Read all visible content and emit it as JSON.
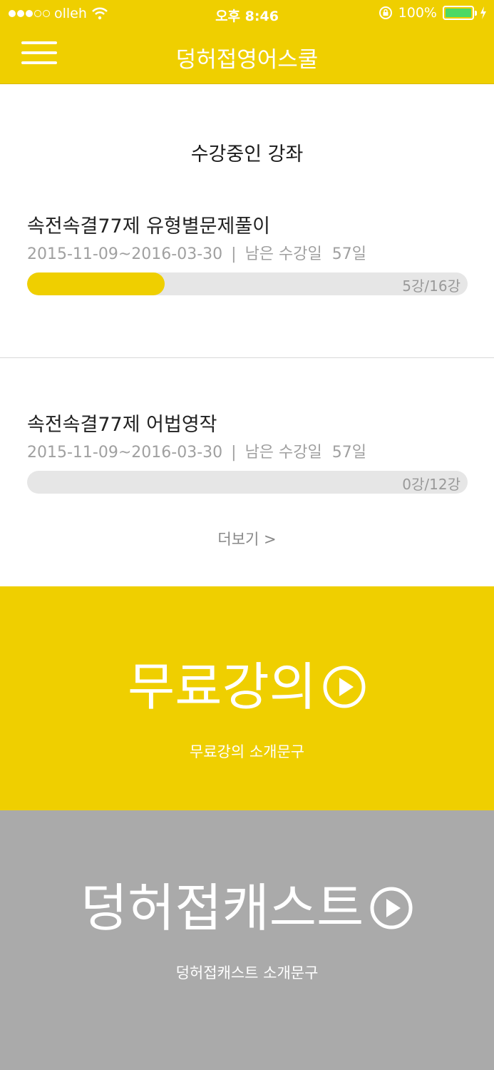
{
  "status": {
    "carrier": "olleh",
    "time": "오후 8:46",
    "battery": "100%",
    "signal_bars_filled": 3,
    "signal_bars_total": 5
  },
  "nav": {
    "title": "덩허접영어스쿨"
  },
  "enrolled": {
    "title": "수강중인 강좌",
    "courses": [
      {
        "title": "속전속결77제 유형별문제풀이",
        "period": "2015-11-09~2016-03-30",
        "separator": "|",
        "remaining_label": "남은 수강일",
        "remaining_days": "57일",
        "progress_text": "5강/16강",
        "progress_fraction": 0.3125
      },
      {
        "title": "속전속결77제 어법영작",
        "period": "2015-11-09~2016-03-30",
        "separator": "|",
        "remaining_label": "남은 수강일",
        "remaining_days": "57일",
        "progress_text": "0강/12강",
        "progress_fraction": 0
      }
    ],
    "more_label": "더보기 >"
  },
  "banners": {
    "free": {
      "title": "무료강의",
      "subtitle": "무료강의 소개문구"
    },
    "cast": {
      "title": "덩허접캐스트",
      "subtitle": "덩허접캐스트 소개문구"
    }
  },
  "colors": {
    "brand_yellow": "#efcf00",
    "cast_gray": "#aaaaaa",
    "battery_green": "#4cd964",
    "progress_track": "#e6e6e6"
  },
  "icons": {
    "menu": "hamburger-menu-icon",
    "play": "play-circle-icon",
    "wifi": "wifi-icon",
    "lock": "rotation-lock-icon",
    "charging": "charging-bolt-icon"
  }
}
